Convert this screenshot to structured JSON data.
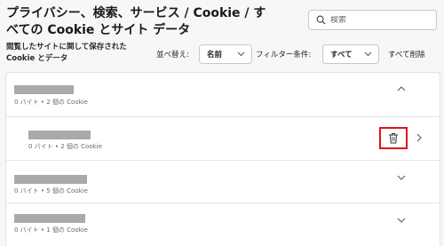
{
  "header": {
    "title": "プライバシー、検索、サービス / Cookie / すべての Cookie とサイト データ",
    "search_placeholder": "検索",
    "subtitle": "閲覧したサイトに関して保存された Cookie とデータ"
  },
  "toolbar": {
    "sort_label": "並べ替え:",
    "sort_value": "名前",
    "filter_label": "フィルター条件:",
    "filter_value": "すべて",
    "delete_all": "すべて削除"
  },
  "sites": [
    {
      "meta": "0 バイト • 2 個の Cookie",
      "expanded": true
    },
    {
      "meta": "0 バイト • 2 個の Cookie",
      "child": true
    },
    {
      "meta": "0 バイト • 5 個の Cookie",
      "expanded": false
    },
    {
      "meta": "0 バイト • 1 個の Cookie",
      "expanded": false
    }
  ],
  "colors": {
    "highlight": "#e0121e",
    "redaction": "#a9a9a9"
  },
  "icons": [
    "search-icon",
    "chevron-down-icon",
    "chevron-up-icon",
    "chevron-right-icon",
    "trash-icon"
  ]
}
